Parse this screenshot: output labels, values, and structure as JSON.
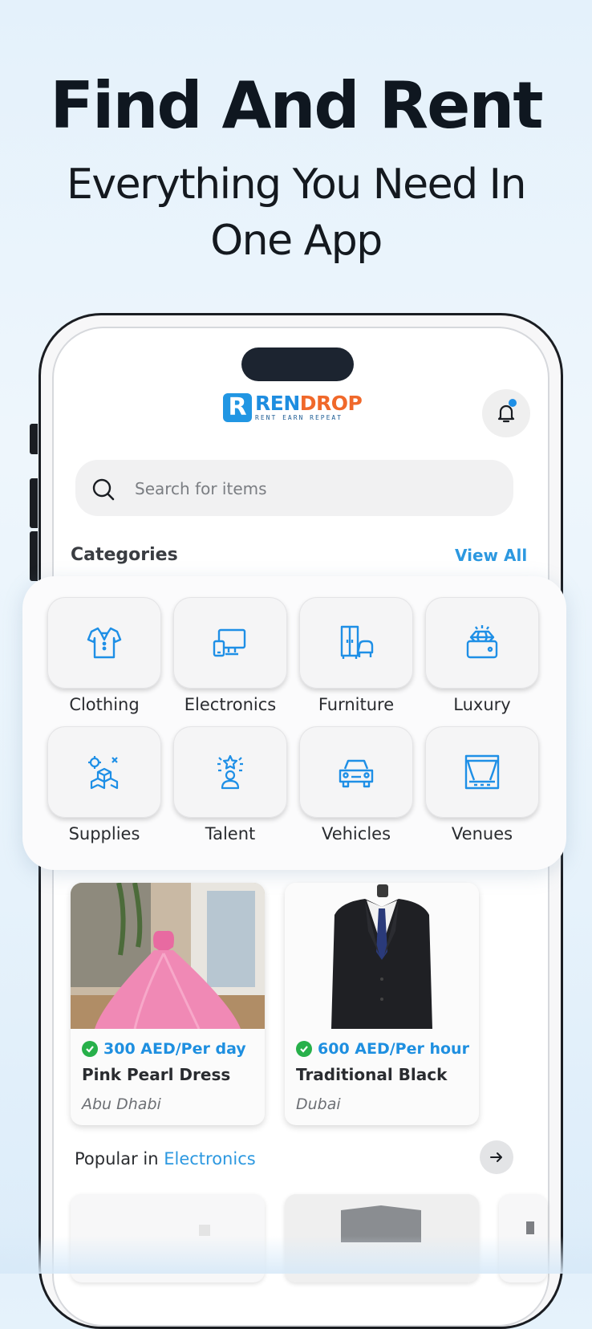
{
  "hero": {
    "title": "Find And Rent",
    "subtitle_line1": "Everything You Need In",
    "subtitle_line2": "One App"
  },
  "header": {
    "logo_name_a": "REN",
    "logo_name_b": "DROP",
    "logo_mark": "R",
    "logo_tagline": "RENT EARN REPEAT",
    "bell_icon": "bell-icon",
    "notification_dot_color": "#1e8fe6"
  },
  "search": {
    "placeholder": "Search for items",
    "icon": "search-icon"
  },
  "categories": {
    "title": "Categories",
    "view_all": "View All",
    "items": [
      {
        "label": "Clothing",
        "icon": "shirt-icon"
      },
      {
        "label": "Electronics",
        "icon": "devices-icon"
      },
      {
        "label": "Furniture",
        "icon": "furniture-icon"
      },
      {
        "label": "Luxury",
        "icon": "diamond-icon"
      },
      {
        "label": "Supplies",
        "icon": "boxes-icon"
      },
      {
        "label": "Talent",
        "icon": "talent-icon"
      },
      {
        "label": "Vehicles",
        "icon": "car-icon"
      },
      {
        "label": "Venues",
        "icon": "stage-icon"
      }
    ],
    "icon_color": "#1e8fe6"
  },
  "listings": [
    {
      "price": "300 AED/Per day",
      "name": "Pink Pearl Dress",
      "location": "Abu Dhabi"
    },
    {
      "price": "600 AED/Per hour",
      "name": "Traditional Black",
      "location": "Dubai"
    }
  ],
  "popular": {
    "prefix": "Popular in ",
    "category": "Electronics"
  },
  "colors": {
    "accent": "#2c98e0",
    "verified": "#27b04a"
  }
}
